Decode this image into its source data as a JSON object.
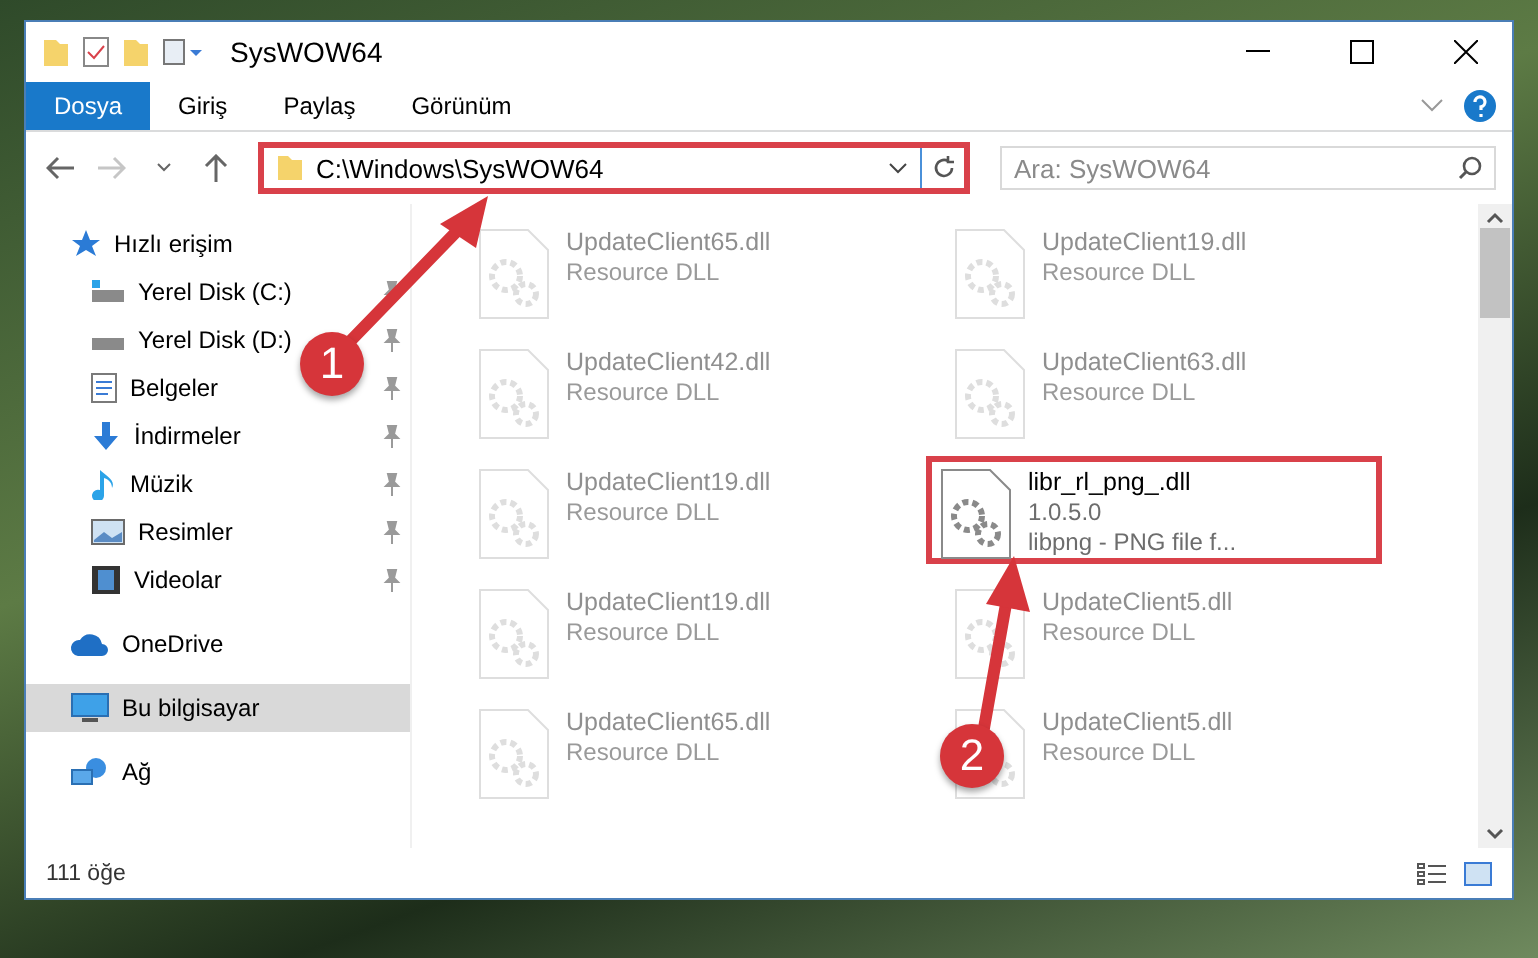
{
  "window": {
    "title": "SysWOW64"
  },
  "ribbon_tabs": [
    {
      "label": "Dosya",
      "selected": true
    },
    {
      "label": "Giriş",
      "selected": false
    },
    {
      "label": "Paylaş",
      "selected": false
    },
    {
      "label": "Görünüm",
      "selected": false
    }
  ],
  "address": {
    "path": "C:\\Windows\\SysWOW64",
    "highlighted": true
  },
  "search": {
    "placeholder": "Ara: SysWOW64"
  },
  "sidebar": {
    "items": [
      {
        "label": "Hızlı erişim",
        "kind": "group",
        "selected": false
      },
      {
        "label": "Yerel Disk (C:)",
        "kind": "pinned",
        "selected": false
      },
      {
        "label": "Yerel Disk (D:)",
        "kind": "pinned",
        "selected": false
      },
      {
        "label": "Belgeler",
        "kind": "pinned",
        "selected": false
      },
      {
        "label": "İndirmeler",
        "kind": "pinned",
        "selected": false
      },
      {
        "label": "Müzik",
        "kind": "pinned",
        "selected": false
      },
      {
        "label": "Resimler",
        "kind": "pinned",
        "selected": false
      },
      {
        "label": "Videolar",
        "kind": "pinned",
        "selected": false
      },
      {
        "label": "OneDrive",
        "kind": "group",
        "selected": false
      },
      {
        "label": "Bu bilgisayar",
        "kind": "group",
        "selected": true
      },
      {
        "label": "Ağ",
        "kind": "group",
        "selected": false
      }
    ]
  },
  "files": [
    {
      "lines": [
        "UpdateClient65.dll",
        "Resource DLL"
      ],
      "highlighted": false
    },
    {
      "lines": [
        "UpdateClient19.dll",
        "Resource DLL"
      ],
      "highlighted": false
    },
    {
      "lines": [
        "UpdateClient42.dll",
        "Resource DLL"
      ],
      "highlighted": false
    },
    {
      "lines": [
        "UpdateClient63.dll",
        "Resource DLL"
      ],
      "highlighted": false
    },
    {
      "lines": [
        "UpdateClient19.dll",
        "Resource DLL"
      ],
      "highlighted": false
    },
    {
      "lines": [
        "libr_rl_png_.dll",
        "1.0.5.0",
        "libpng - PNG file f..."
      ],
      "highlighted": true
    },
    {
      "lines": [
        "UpdateClient19.dll",
        "Resource DLL"
      ],
      "highlighted": false
    },
    {
      "lines": [
        "UpdateClient5.dll",
        "Resource DLL"
      ],
      "highlighted": false
    },
    {
      "lines": [
        "UpdateClient65.dll",
        "Resource DLL"
      ],
      "highlighted": false
    },
    {
      "lines": [
        "UpdateClient5.dll",
        "Resource DLL"
      ],
      "highlighted": false
    }
  ],
  "status_bar": {
    "count": "111 öğe"
  },
  "annotations": [
    {
      "number": "1"
    },
    {
      "number": "2"
    }
  ]
}
